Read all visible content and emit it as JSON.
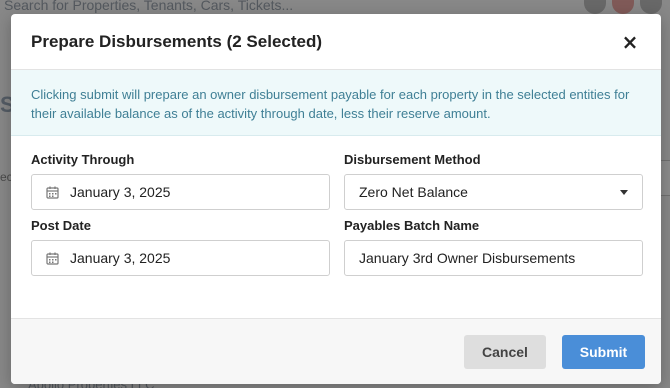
{
  "background": {
    "search_placeholder": "Search for Properties, Tenants, Cars, Tickets...",
    "left_letter": "S",
    "left_fragment": "ec",
    "footer_text": "Apollo Properties LLC"
  },
  "modal": {
    "title": "Prepare Disbursements (2 Selected)",
    "close_icon": "×",
    "info_text": "Clicking submit will prepare an owner disbursement payable for each property in the selected entities for their available balance as of the activity through date, less their reserve amount.",
    "fields": {
      "activity_through": {
        "label": "Activity Through",
        "value": "January 3, 2025"
      },
      "disbursement_method": {
        "label": "Disbursement Method",
        "value": "Zero Net Balance"
      },
      "post_date": {
        "label": "Post Date",
        "value": "January 3, 2025"
      },
      "payables_batch_name": {
        "label": "Payables Batch Name",
        "value": "January 3rd Owner Disbursements"
      }
    },
    "buttons": {
      "cancel": "Cancel",
      "submit": "Submit"
    }
  },
  "colors": {
    "accent": "#4a8ed8",
    "info_text": "#3f7f95",
    "info_bg": "#eef9fa"
  }
}
